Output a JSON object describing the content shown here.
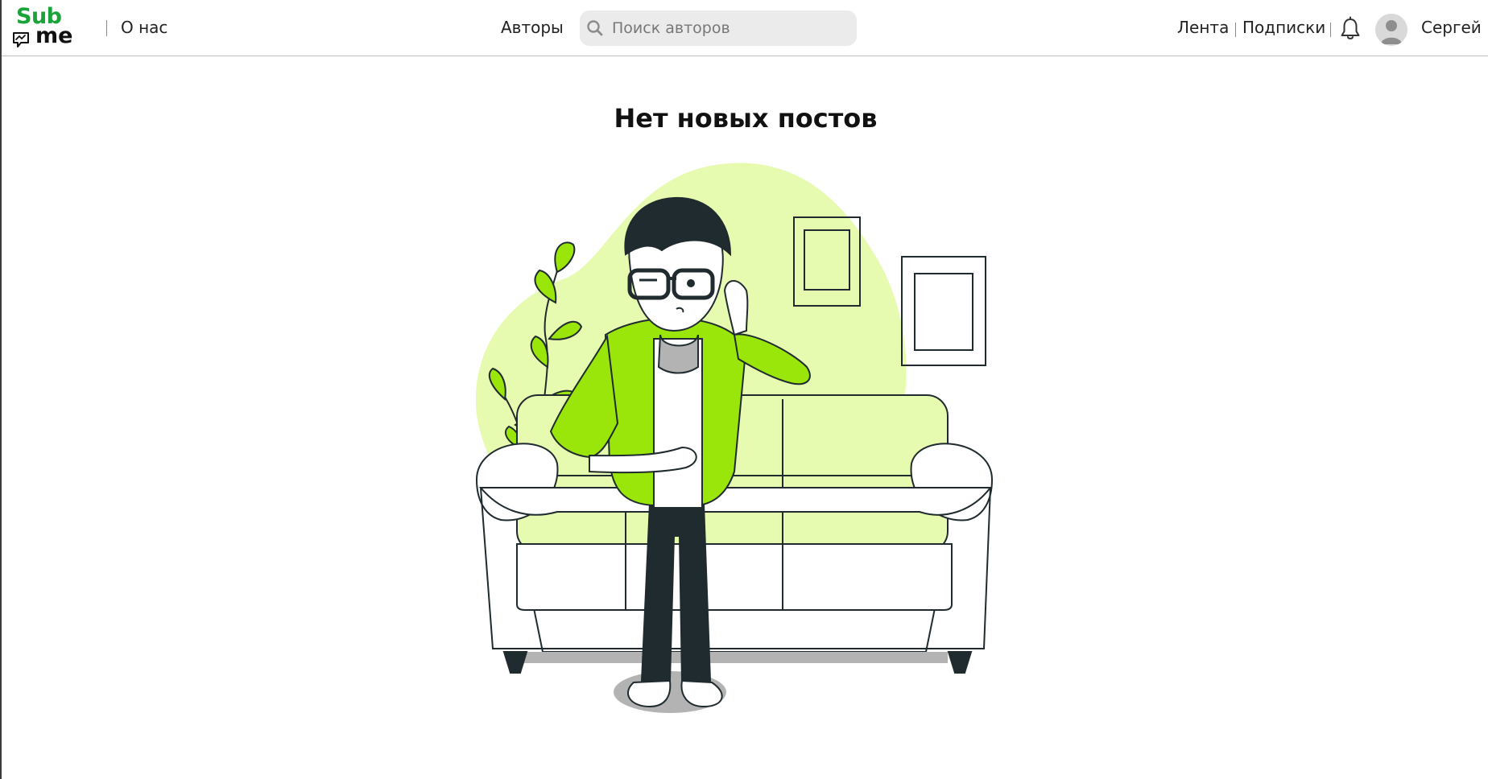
{
  "brand": {
    "logo_top": "Sub",
    "logo_bottom": "me",
    "brand_color": "#1aa33a"
  },
  "nav": {
    "about": "О нас",
    "authors": "Авторы",
    "feed": "Лента",
    "subscriptions": "Подписки"
  },
  "search": {
    "placeholder": "Поиск авторов",
    "value": ""
  },
  "user": {
    "name": "Сергей"
  },
  "main": {
    "empty_title": "Нет новых постов"
  },
  "icons": {
    "search": "search-icon",
    "bell": "bell-icon",
    "avatar": "user-avatar-icon"
  },
  "colors": {
    "accent": "#9be60a",
    "accent_light": "#e6fbb0",
    "accent_dark": "#73b300",
    "dark": "#1f2b2f",
    "header_border": "#bdbdbd",
    "search_bg": "#ebebeb"
  }
}
